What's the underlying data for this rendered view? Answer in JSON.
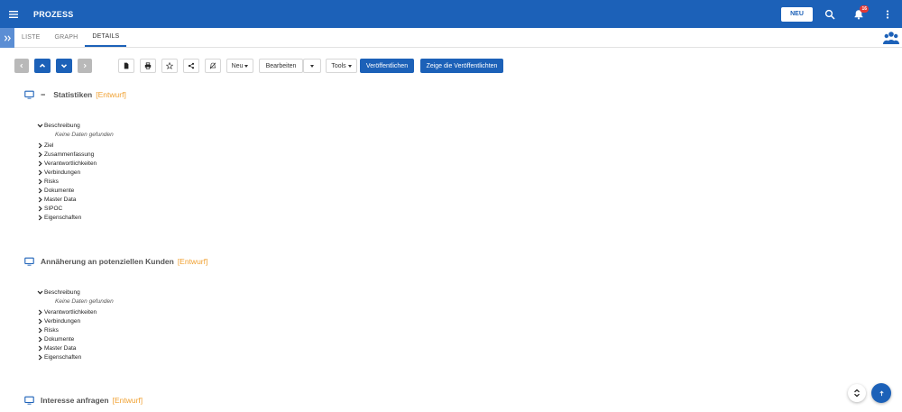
{
  "header": {
    "title": "PROZESS",
    "new_label": "NEU",
    "notification_count": "16",
    "bg_color": "#1c61b8"
  },
  "tabs": [
    {
      "label": "LISTE"
    },
    {
      "label": "GRAPH"
    },
    {
      "label": "DETAILS",
      "active": true
    }
  ],
  "toolbar": {
    "neu_label": "Neu",
    "bearbeiten_label": "Bearbeiten",
    "tools_label": "Tools",
    "publish_label": "Veröffentlichen",
    "show_published_label": "Zeige die Veröffentlichten"
  },
  "sections": [
    {
      "title": "Statistiken",
      "draft": "[Entwurf]",
      "expanded_item": "Beschreibung",
      "empty_text": "Keine Daten gefunden",
      "items": [
        "Ziel",
        "Zusammenfassung",
        "Verantwortlichkeiten",
        "Verbindungen",
        "Risks",
        "Dokumente",
        "Master Data",
        "SIPOC",
        "Eigenschaften"
      ]
    },
    {
      "title": "Annäherung an potenziellen Kunden",
      "draft": "[Entwurf]",
      "expanded_item": "Beschreibung",
      "empty_text": "Keine Daten gefunden",
      "items": [
        "Verantwortlichkeiten",
        "Verbindungen",
        "Risks",
        "Dokumente",
        "Master Data",
        "Eigenschaften"
      ]
    },
    {
      "title": "Interesse anfragen",
      "draft": "[Entwurf]"
    }
  ],
  "icons": {
    "menu": "hamburger-icon",
    "search": "search-icon",
    "notifications": "bell-icon",
    "more": "more-vert-icon",
    "expand": "double-chevron-right-icon",
    "group": "group-icon",
    "scroll_top": "arrow-up-icon",
    "sort": "unfold-icon"
  }
}
